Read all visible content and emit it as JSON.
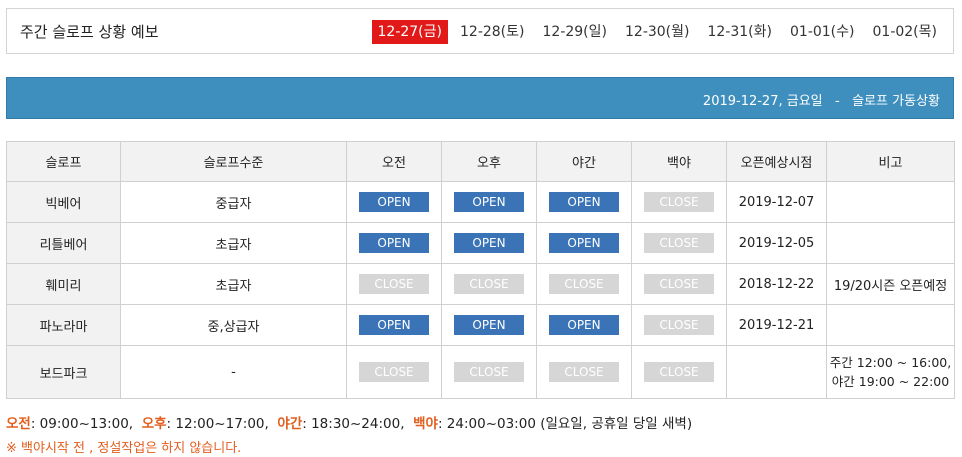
{
  "header": {
    "title": "주간 슬로프 상황 예보",
    "dates": [
      "12-27(금)",
      "12-28(토)",
      "12-29(일)",
      "12-30(월)",
      "12-31(화)",
      "01-01(수)",
      "01-02(목)"
    ],
    "active_date": "12-27(금)"
  },
  "banner": {
    "date_text": "2019-12-27, 금요일",
    "separator": "-",
    "status_text": "슬로프 가동상황"
  },
  "table": {
    "headers": [
      "슬로프",
      "슬로프수준",
      "오전",
      "오후",
      "야간",
      "백야",
      "오픈예상시점",
      "비고"
    ],
    "rows": [
      {
        "name": "빅베어",
        "level": "중급자",
        "am": "OPEN",
        "pm": "OPEN",
        "night": "OPEN",
        "late": "CLOSE",
        "open_date": "2019-12-07",
        "note": ""
      },
      {
        "name": "리틀베어",
        "level": "초급자",
        "am": "OPEN",
        "pm": "OPEN",
        "night": "OPEN",
        "late": "CLOSE",
        "open_date": "2019-12-05",
        "note": ""
      },
      {
        "name": "훼미리",
        "level": "초급자",
        "am": "CLOSE",
        "pm": "CLOSE",
        "night": "CLOSE",
        "late": "CLOSE",
        "open_date": "2018-12-22",
        "note": "19/20시즌 오픈예정"
      },
      {
        "name": "파노라마",
        "level": "중,상급자",
        "am": "OPEN",
        "pm": "OPEN",
        "night": "OPEN",
        "late": "CLOSE",
        "open_date": "2019-12-21",
        "note": ""
      },
      {
        "name": "보드파크",
        "level": "-",
        "am": "CLOSE",
        "pm": "CLOSE",
        "night": "CLOSE",
        "late": "CLOSE",
        "open_date": "",
        "note_line1": "주간 12:00 ~ 16:00,",
        "note_line2": "야간 19:00 ~ 22:00"
      }
    ]
  },
  "legend": {
    "am_label": "오전",
    "am_time": ": 09:00~13:00,",
    "pm_label": "오후",
    "pm_time": ": 12:00~17:00,",
    "night_label": "야간",
    "night_time": ": 18:30~24:00,",
    "late_label": "백야",
    "late_time": ": 24:00~03:00 (일요일, 공휴일 당일 새벽)"
  },
  "warning": "※ 백야시작 전 , 정설작업은 하지 않습니다.",
  "colors": {
    "active_tab": "#e11919",
    "banner": "#3f8fbe",
    "open_button": "#3a74b6",
    "close_button": "#d6d6d6",
    "legend_label": "#e25e1d"
  }
}
